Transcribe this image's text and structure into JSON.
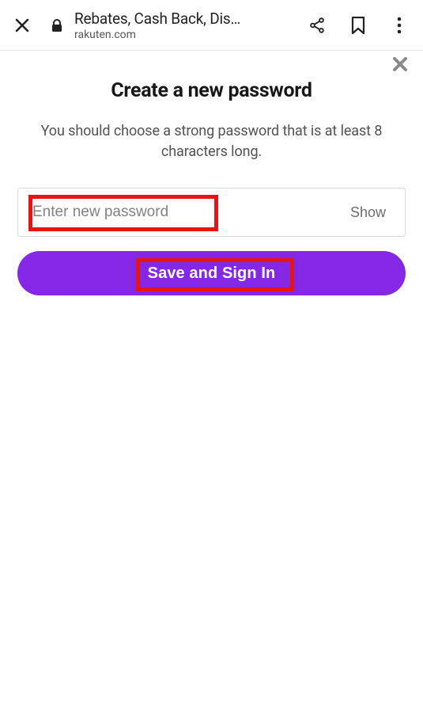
{
  "browser": {
    "title": "Rebates, Cash Back, Dis…",
    "domain": "rakuten.com"
  },
  "modal": {
    "heading": "Create a new password",
    "subtext": "You should choose a strong password that is at least 8 characters long.",
    "password_placeholder": "Enter new password",
    "show_label": "Show",
    "cta_label": "Save and Sign In"
  }
}
